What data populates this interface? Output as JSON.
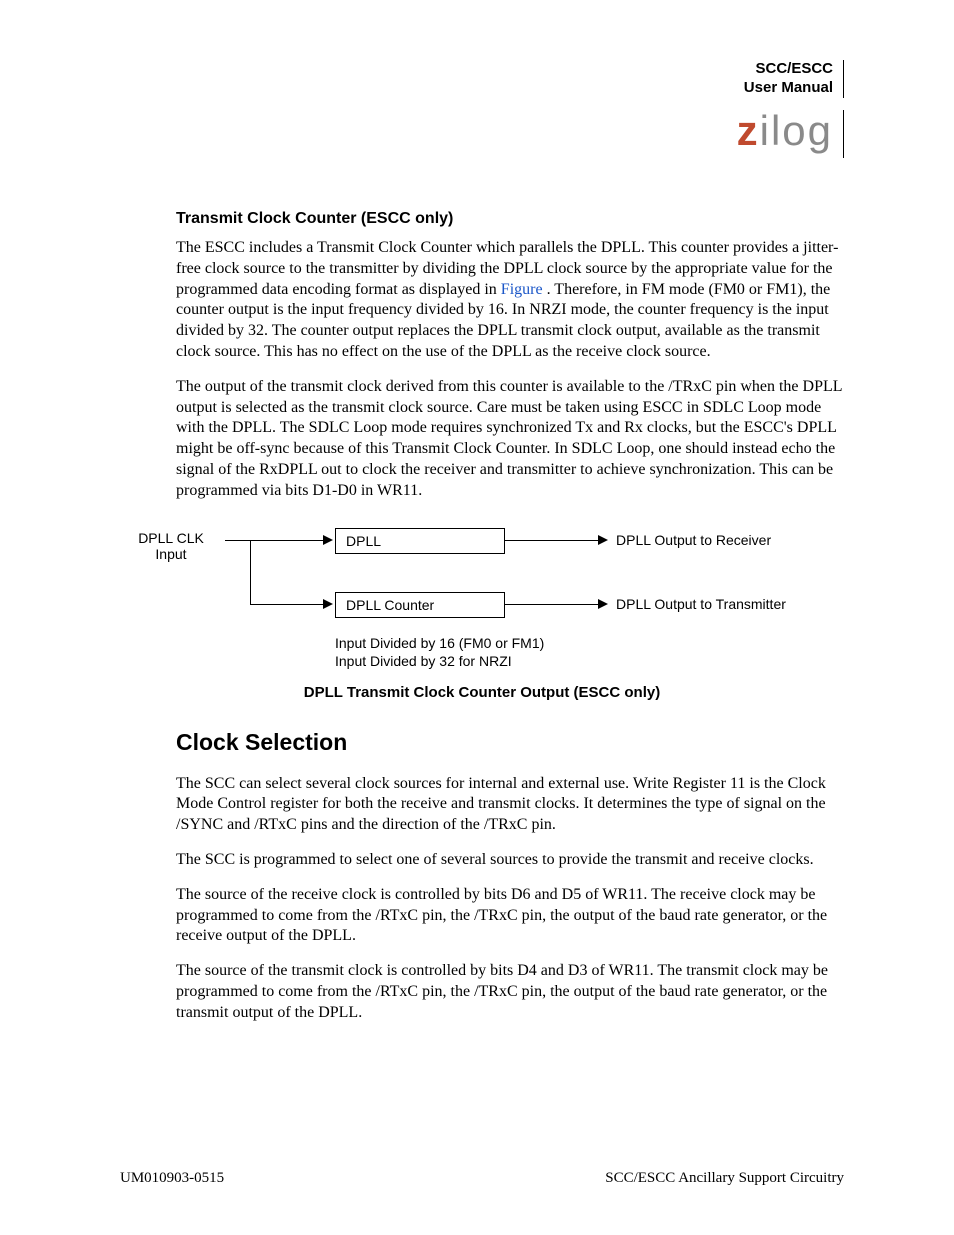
{
  "header": {
    "line1": "SCC/ESCC",
    "line2": "User Manual",
    "logo_rest": "ilog"
  },
  "section1": {
    "heading": "Transmit Clock Counter (ESCC only)",
    "p1a": "The ESCC includes a Transmit Clock Counter which parallels the DPLL. This counter provides a jitter-free clock source to the transmitter by dividing the DPLL clock source by the appropriate value for the programmed data encoding format as displayed in ",
    "p1_link": "Figure ",
    "p1b": ". Therefore, in FM mode (FM0 or FM1), the counter output is the input frequency divided by 16. In NRZI mode, the counter frequency is the input divided by 32. The counter output replaces the DPLL transmit clock output, available as the transmit clock source. This has no effect on the use of the DPLL as the receive clock source.",
    "p2": "The output of the transmit clock derived from this counter is available to the /TRxC pin when the DPLL output is selected as the transmit clock source. Care must be taken using ESCC in SDLC Loop mode with the DPLL. The SDLC Loop mode requires synchronized Tx and Rx clocks, but the ESCC's DPLL might be off-sync because of this Transmit Clock Counter. In SDLC Loop, one should instead echo the signal of the RxDPLL out to clock the receiver and transmitter to achieve synchronization. This can be programmed via bits D1-D0 in WR11."
  },
  "diagram": {
    "input_label_l1": "DPLL CLK",
    "input_label_l2": "Input",
    "box1": "DPLL",
    "box2": "DPLL Counter",
    "out1": "DPLL Output to Receiver",
    "out2": "DPLL Output to Transmitter",
    "div1": "Input Divided by 16 (FM0 or FM1)",
    "div2": "Input Divided by 32 for NRZI",
    "caption": "DPLL Transmit Clock Counter Output (ESCC only)"
  },
  "section2": {
    "heading": "Clock Selection",
    "p1": "The SCC can select several clock sources for internal and external use. Write Register 11 is the Clock Mode Control register for both the receive and transmit clocks. It determines the type of signal on the /SYNC and /RTxC pins and the direction of the /TRxC pin.",
    "p2": "The SCC is programmed to select one of several sources to provide the transmit and receive clocks.",
    "p3": "The source of the receive clock is controlled by bits D6 and D5 of WR11. The receive clock may be programmed to come from the /RTxC pin, the /TRxC pin, the output of the baud rate generator, or the receive output of the DPLL.",
    "p4": "The source of the transmit clock is controlled by bits D4 and D3 of WR11. The transmit clock may be programmed to come from the /RTxC pin, the /TRxC pin, the output of the baud rate generator, or the transmit output of the DPLL."
  },
  "footer": {
    "left": "UM010903-0515",
    "right": "SCC/ESCC Ancillary Support Circuitry"
  }
}
